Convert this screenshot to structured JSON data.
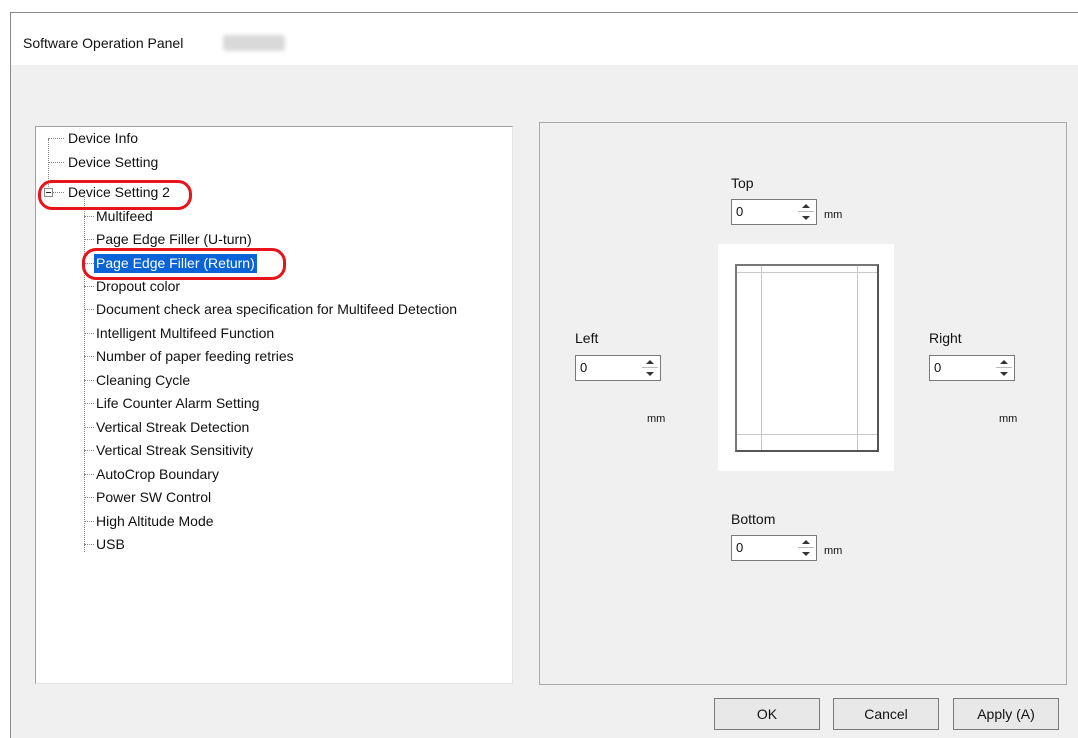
{
  "window": {
    "title": "Software Operation Panel"
  },
  "tree": {
    "items": [
      {
        "label": "Device Info"
      },
      {
        "label": "Device Setting"
      },
      {
        "label": "Device Setting 2"
      },
      {
        "label": "Multifeed"
      },
      {
        "label": "Page Edge Filler (U-turn)"
      },
      {
        "label": "Page Edge Filler (Return)"
      },
      {
        "label": "Dropout color"
      },
      {
        "label": "Document check area specification for Multifeed Detection"
      },
      {
        "label": "Intelligent Multifeed Function"
      },
      {
        "label": "Number of paper feeding retries"
      },
      {
        "label": "Cleaning Cycle"
      },
      {
        "label": "Life Counter Alarm Setting"
      },
      {
        "label": "Vertical Streak Detection"
      },
      {
        "label": "Vertical Streak Sensitivity"
      },
      {
        "label": "AutoCrop Boundary"
      },
      {
        "label": "Power SW Control"
      },
      {
        "label": "High Altitude Mode"
      },
      {
        "label": "USB"
      }
    ],
    "selected_label": "Page Edge Filler (Return)"
  },
  "panel": {
    "top": {
      "label": "Top",
      "value": "0",
      "unit": "mm"
    },
    "left": {
      "label": "Left",
      "value": "0",
      "unit": "mm"
    },
    "right": {
      "label": "Right",
      "value": "0",
      "unit": "mm"
    },
    "bottom": {
      "label": "Bottom",
      "value": "0",
      "unit": "mm"
    }
  },
  "buttons": {
    "ok": "OK",
    "cancel": "Cancel",
    "apply": "Apply (A)"
  },
  "colors": {
    "selection": "#0a64d8",
    "highlight_ring": "#e8141c"
  }
}
